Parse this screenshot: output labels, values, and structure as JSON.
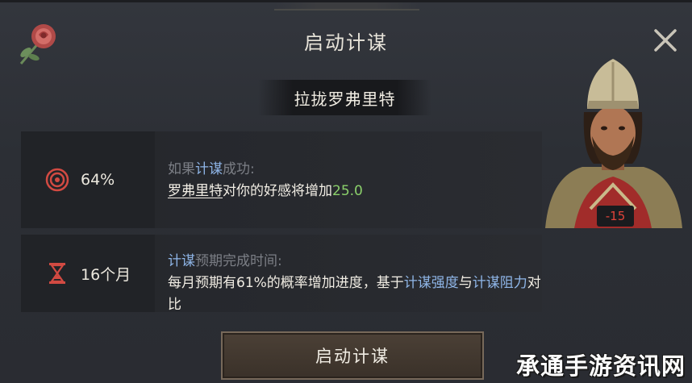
{
  "dialog": {
    "title": "启动计谋",
    "target_name": "拉拢罗弗里特"
  },
  "success": {
    "chance": "64%",
    "line1_prefix": "如果",
    "line1_keyword": "计谋",
    "line1_suffix": "成功:",
    "line2_name": "罗弗里特",
    "line2_mid": "对你的好感将增加",
    "line2_value": "25.0"
  },
  "duration": {
    "value": "16个月",
    "line1_keyword": "计谋",
    "line1_suffix": "预期完成时间:",
    "line2_prefix": "每月预期有61%的概率增加进度，基于",
    "line2_kw1": "计谋强度",
    "line2_and": "与",
    "line2_kw2": "计谋阻力",
    "line2_suffix": "对比"
  },
  "portrait": {
    "opinion": "-15"
  },
  "actions": {
    "launch_label": "启动计谋"
  },
  "watermark": {
    "text": "承通手游资讯网"
  },
  "icons": {
    "header": "rose-icon",
    "close": "close-icon",
    "success": "target-icon",
    "duration": "hourglass-icon"
  },
  "colors": {
    "accent_blue": "#8fb6e8",
    "positive_green": "#8bd06b",
    "negative_red": "#e0433a"
  }
}
